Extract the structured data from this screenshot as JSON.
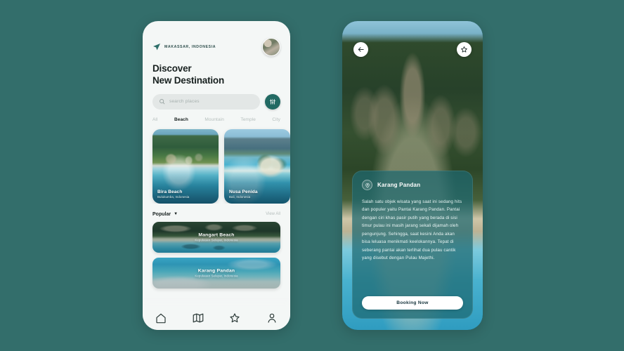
{
  "theme": {
    "background": "#336e6b",
    "accent": "#226a63",
    "panel": "#1d6870",
    "text_dark": "#17201f",
    "text_muted": "#b6bfbd"
  },
  "home": {
    "brand": {
      "icon": "send-icon",
      "label": "MAKASSAR, INDONESIA"
    },
    "avatar": "user-avatar",
    "headline_line1": "Discover",
    "headline_line2": "New Destination",
    "search": {
      "placeholder": "search places",
      "icon": "search-icon",
      "filter_icon": "filter-sliders-icon"
    },
    "tabs": [
      {
        "label": "All",
        "active": false
      },
      {
        "label": "Beach",
        "active": true
      },
      {
        "label": "Mountain",
        "active": false
      },
      {
        "label": "Temple",
        "active": false
      },
      {
        "label": "City",
        "active": false
      }
    ],
    "destinations": [
      {
        "title": "Bira Beach",
        "subtitle": "Bulukumba, Indonesia"
      },
      {
        "title": "Nusa Penida",
        "subtitle": "Bali, Indonesia"
      }
    ],
    "popular": {
      "title": "Popular",
      "caret": "▼",
      "view_all": "View All",
      "items": [
        {
          "title": "Mangart Beach",
          "subtitle": "Kepulauan Selayar, Indonesia"
        },
        {
          "title": "Karang Pandan",
          "subtitle": "Kepulauan Selayar, Indonesia"
        }
      ]
    },
    "bottom_nav": [
      {
        "icon": "home-icon",
        "label": "Home"
      },
      {
        "icon": "map-icon",
        "label": "Map"
      },
      {
        "icon": "star-icon",
        "label": "Favorites"
      },
      {
        "icon": "profile-icon",
        "label": "Profile"
      }
    ]
  },
  "detail": {
    "back_icon": "back-arrow-icon",
    "bookmark_icon": "star-icon",
    "pin_icon": "location-pin-icon",
    "title": "Karang Pandan",
    "description": "Salah satu objek wisata yang saat ini sedang hits dan populer yaitu Pantai Karang Pandan. Pantai dengan ciri khas pasir putih yang berada di sisi timur pulau ini masih jarang sekali dijamah oleh pengunjung. Sehingga, saat kesini Anda akan bisa leluasa menikmati keelokannya. Tepat di seberang pantai akan terlihat dua pulau cantik yang disebut dengan Pulau Majethi.",
    "booking_label": "Booking Now"
  }
}
